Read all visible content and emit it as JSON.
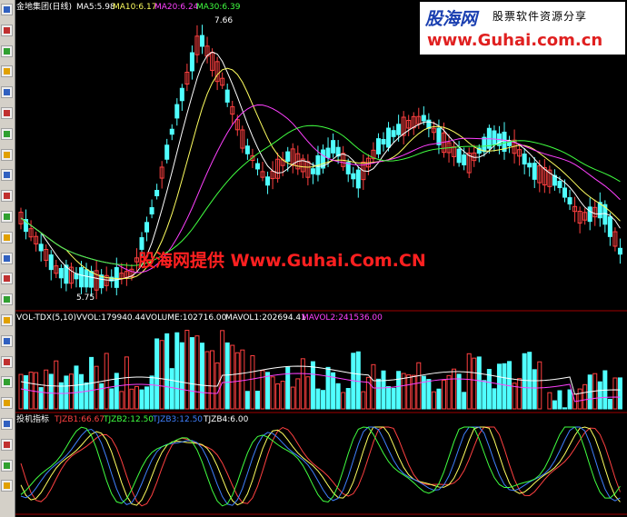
{
  "panel1": {
    "stock_title": "金地集团(日线)",
    "ma5_label": "MA5:5.98",
    "ma10_label": "MA10:6.17",
    "ma20_label": "MA20:6.24",
    "ma30_label": "MA30:6.39",
    "high_label": "7.66",
    "low_label": "5.75",
    "watermark": "股海网提供 Www.Guhai.Com.CN"
  },
  "panel2": {
    "indicator": "VOL-TDX(5,10)",
    "vvol": "VVOL:179940.44",
    "volume": "VOLUME:102716.00",
    "mavol1": "MAVOL1:202694.41",
    "mavol2": "MAVOL2:241536.00"
  },
  "panel3": {
    "indicator": "投机指标",
    "tjzb1": "TJZB1:66.67",
    "tjzb2": "TJZB2:12.50",
    "tjzb3": "TJZB3:12.50",
    "tjzb4": "TJZB4:6.00"
  },
  "logo": {
    "brand": "股海网",
    "slogan": "股票软件资源分享",
    "url": "www.Guhai.com.cn"
  },
  "colors": {
    "up": "#ff4040",
    "down": "#50ffff",
    "ma5": "#ffffff",
    "ma10": "#ffff60",
    "ma20": "#ff40ff",
    "ma30": "#40ff40"
  },
  "toolbar": {
    "icons": [
      "chart-icon",
      "line-icon",
      "bar-icon",
      "table-icon",
      "list-icon",
      "grid-icon",
      "news-icon",
      "info-icon",
      "doc-icon",
      "f10-icon",
      "calc-icon",
      "window-icon",
      "msg-icon",
      "tile-icon",
      "layout-icon",
      "panel-icon",
      "box-icon",
      "sheet-icon",
      "export-icon",
      "import-icon",
      "pen-icon",
      "up-arrow-icon",
      "move-icon",
      "down-arrow-icon"
    ]
  }
}
